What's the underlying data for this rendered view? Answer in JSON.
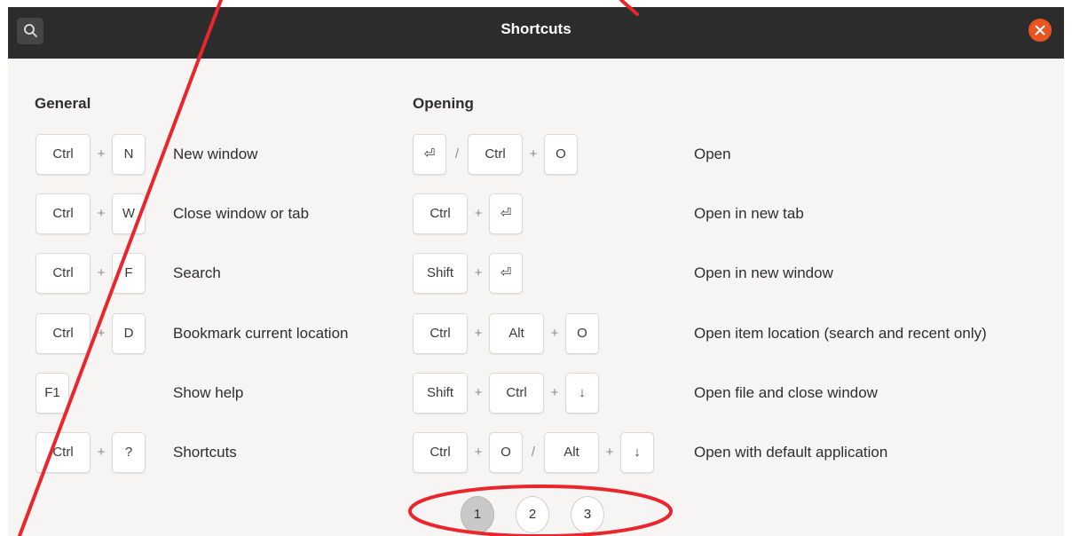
{
  "window": {
    "title": "Shortcuts"
  },
  "sections": {
    "general": {
      "title": "General",
      "shortcuts": [
        {
          "keys": [
            "Ctrl",
            "+",
            "N"
          ],
          "description": "New window"
        },
        {
          "keys": [
            "Ctrl",
            "+",
            "W"
          ],
          "description": "Close window or tab"
        },
        {
          "keys": [
            "Ctrl",
            "+",
            "F"
          ],
          "description": "Search"
        },
        {
          "keys": [
            "Ctrl",
            "+",
            "D"
          ],
          "description": "Bookmark current location"
        },
        {
          "keys": [
            "F1"
          ],
          "description": "Show help"
        },
        {
          "keys": [
            "Ctrl",
            "+",
            "?"
          ],
          "description": "Shortcuts"
        }
      ]
    },
    "opening": {
      "title": "Opening",
      "shortcuts": [
        {
          "keys": [
            "⏎",
            "/",
            "Ctrl",
            "+",
            "O"
          ],
          "description": "Open"
        },
        {
          "keys": [
            "Ctrl",
            "+",
            "⏎"
          ],
          "description": "Open in new tab"
        },
        {
          "keys": [
            "Shift",
            "+",
            "⏎"
          ],
          "description": "Open in new window"
        },
        {
          "keys": [
            "Ctrl",
            "+",
            "Alt",
            "+",
            "O"
          ],
          "description": "Open item location (search and recent only)"
        },
        {
          "keys": [
            "Shift",
            "+",
            "Ctrl",
            "+",
            "↓"
          ],
          "description": "Open file and close window"
        },
        {
          "keys": [
            "Ctrl",
            "+",
            "O",
            "/",
            "Alt",
            "+",
            "↓"
          ],
          "description": "Open with default application"
        }
      ]
    }
  },
  "pager": {
    "pages": [
      "1",
      "2",
      "3"
    ],
    "active": "1"
  },
  "icons": {
    "search": "search-icon",
    "close": "close-icon"
  },
  "colors": {
    "titlebar": "#2c2c2c",
    "close_button": "#e95420",
    "background": "#f6f5f4",
    "annotation": "#e8262b"
  }
}
